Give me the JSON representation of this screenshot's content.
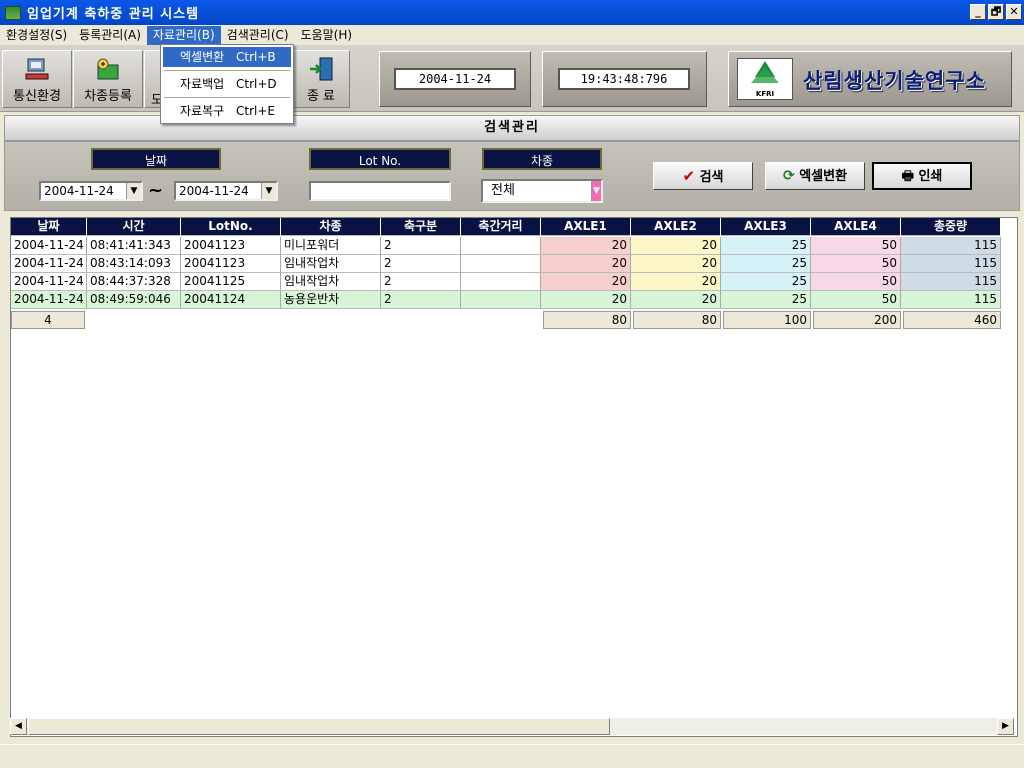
{
  "window": {
    "title": "임업기계 축하중 관리 시스템",
    "min": "_",
    "restore": "🗗",
    "close": "✕"
  },
  "menu": [
    {
      "label": "환경설정(S)"
    },
    {
      "label": "등록관리(A)"
    },
    {
      "label": "자료관리(B)"
    },
    {
      "label": "검색관리(C)"
    },
    {
      "label": "도움말(H)"
    }
  ],
  "dropdown": {
    "items": [
      {
        "label": "엑셀변환",
        "shortcut": "Ctrl+B"
      },
      {
        "label": "자료백업",
        "shortcut": "Ctrl+D"
      },
      {
        "label": "자료복구",
        "shortcut": "Ctrl+E"
      }
    ]
  },
  "toolbar": {
    "comm_label": "통신환경",
    "register_label": "차종등록",
    "third_label_partial": "도",
    "exit_label": "종 료",
    "date": "2004-11-24",
    "time": "19:43:48:796",
    "logo_text": "산림생산기술연구소",
    "logo_badge": "KFRI"
  },
  "section_title": "검색관리",
  "filter": {
    "date_label": "날짜",
    "lot_label": "Lot No.",
    "type_label": "차종",
    "date_from": "2004-11-24",
    "date_to": "2004-11-24",
    "tilde": "~",
    "lot_value": "",
    "type_value": "전체",
    "search_button": "검색",
    "excel_button": "엑셀변환",
    "print_button": "인쇄"
  },
  "table": {
    "headers": [
      "날짜",
      "시간",
      "LotNo.",
      "차종",
      "축구분",
      "축간거리",
      "AXLE1",
      "AXLE2",
      "AXLE3",
      "AXLE4",
      "총중량"
    ],
    "rows": [
      [
        "2004-11-24",
        "08:41:41:343",
        "20041123",
        "미니포워더",
        "2",
        "",
        "20",
        "20",
        "25",
        "50",
        "115"
      ],
      [
        "2004-11-24",
        "08:43:14:093",
        "20041123",
        "임내작업차",
        "2",
        "",
        "20",
        "20",
        "25",
        "50",
        "115"
      ],
      [
        "2004-11-24",
        "08:44:37:328",
        "20041125",
        "임내작업차",
        "2",
        "",
        "20",
        "20",
        "25",
        "50",
        "115"
      ],
      [
        "2004-11-24",
        "08:49:59:046",
        "20041124",
        "농용운반차",
        "2",
        "",
        "20",
        "20",
        "25",
        "50",
        "115"
      ]
    ],
    "summary": {
      "count": "4",
      "axle1": "80",
      "axle2": "80",
      "axle3": "100",
      "axle4": "200",
      "total": "460"
    }
  },
  "colors": {
    "axle1_bg": "#f8cfcf",
    "axle2_bg": "#fbf7c6",
    "axle3_bg": "#d4f2f8",
    "axle4_bg": "#f8d8e8",
    "total_bg": "#cfdce6",
    "selected_row_bg": "#d8f5d8",
    "header_bg": "#0a1244"
  }
}
